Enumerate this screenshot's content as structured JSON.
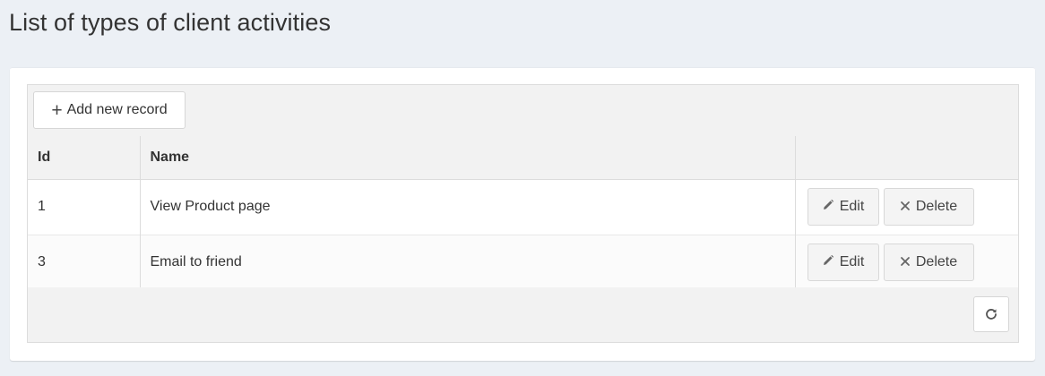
{
  "page": {
    "title": "List of types of client activities"
  },
  "toolbar": {
    "add_label": "Add new record",
    "add_icon": "plus-icon"
  },
  "table": {
    "columns": [
      "Id",
      "Name",
      ""
    ],
    "rows": [
      {
        "id": "1",
        "name": "View Product page",
        "edit_label": "Edit",
        "delete_label": "Delete"
      },
      {
        "id": "3",
        "name": "Email to friend",
        "edit_label": "Edit",
        "delete_label": "Delete"
      }
    ]
  },
  "footer": {
    "refresh_icon": "refresh-icon"
  },
  "colors": {
    "background": "#ecf0f5",
    "card": "#ffffff",
    "grid_header": "#f2f2f2",
    "button_gray": "#f4f4f4"
  }
}
